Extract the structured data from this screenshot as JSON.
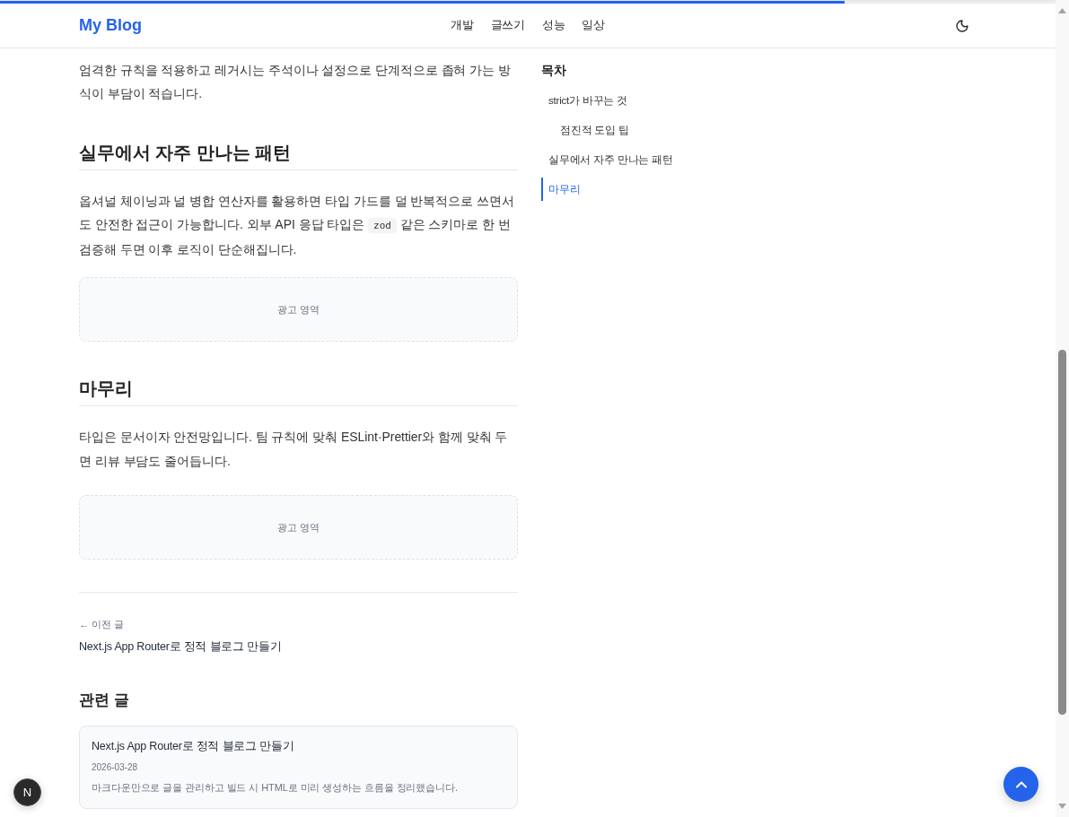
{
  "reading_progress": {
    "level": 0.8
  },
  "header": {
    "logo": "My Blog",
    "nav": [
      {
        "label": "개발"
      },
      {
        "label": "글쓰기"
      },
      {
        "label": "성능"
      },
      {
        "label": "일상"
      }
    ]
  },
  "article": {
    "blocks": [
      {
        "kind": "paragraph",
        "segments": [
          {
            "kind": "text",
            "text": "엄격한 규칙을 적용하고 레거시는 주석이나 설정으로 단계적으로 좁혀 가는 방식이 부담이 적습니다."
          }
        ]
      },
      {
        "kind": "heading",
        "text": "실무에서 자주 만나는 패턴"
      },
      {
        "kind": "paragraph",
        "segments": [
          {
            "kind": "text",
            "text": "옵셔널 체이닝과 널 병합 연산자를 활용하면 타입 가드를 덜 반복적으로 쓰면서도 안전한 접근이 가능합니다. 외부 API 응답 타입은 "
          },
          {
            "kind": "code",
            "text": "zod"
          },
          {
            "kind": "text",
            "text": " 같은 스키마로 한 번 검증해 두면 이후 로직이 단순해집니다."
          }
        ]
      },
      {
        "kind": "ad",
        "text": "광고 영역"
      },
      {
        "kind": "heading",
        "text": "마무리"
      },
      {
        "kind": "paragraph",
        "segments": [
          {
            "kind": "text",
            "text": "타입은 문서이자 안전망입니다. 팀 규칙에 맞춰 ESLint·Prettier와 함께 맞춰 두면 리뷰 부담도 줄어듭니다."
          }
        ]
      },
      {
        "kind": "ad",
        "text": "광고 영역"
      }
    ]
  },
  "post_nav": {
    "label": "← 이전 글",
    "title": "Next.js App Router로 정적 블로그 만들기"
  },
  "related": {
    "heading": "관련 글",
    "posts": [
      {
        "title": "Next.js App Router로 정적 블로그 만들기",
        "date": "2026-03-28",
        "excerpt": "마크다운만으로 글을 관리하고 빌드 시 HTML로 미리 생성하는 흐름을 정리했습니다."
      }
    ]
  },
  "toc": {
    "title": "목차",
    "items": [
      {
        "label": "strict가 바꾸는 것",
        "selected": false,
        "children": [
          {
            "label": "점진적 도입 팁",
            "selected": false
          }
        ]
      },
      {
        "label": "실무에서 자주 만나는 패턴",
        "selected": false
      },
      {
        "label": "마무리",
        "selected": true
      }
    ]
  },
  "dev_indicator": {
    "label": "N"
  }
}
